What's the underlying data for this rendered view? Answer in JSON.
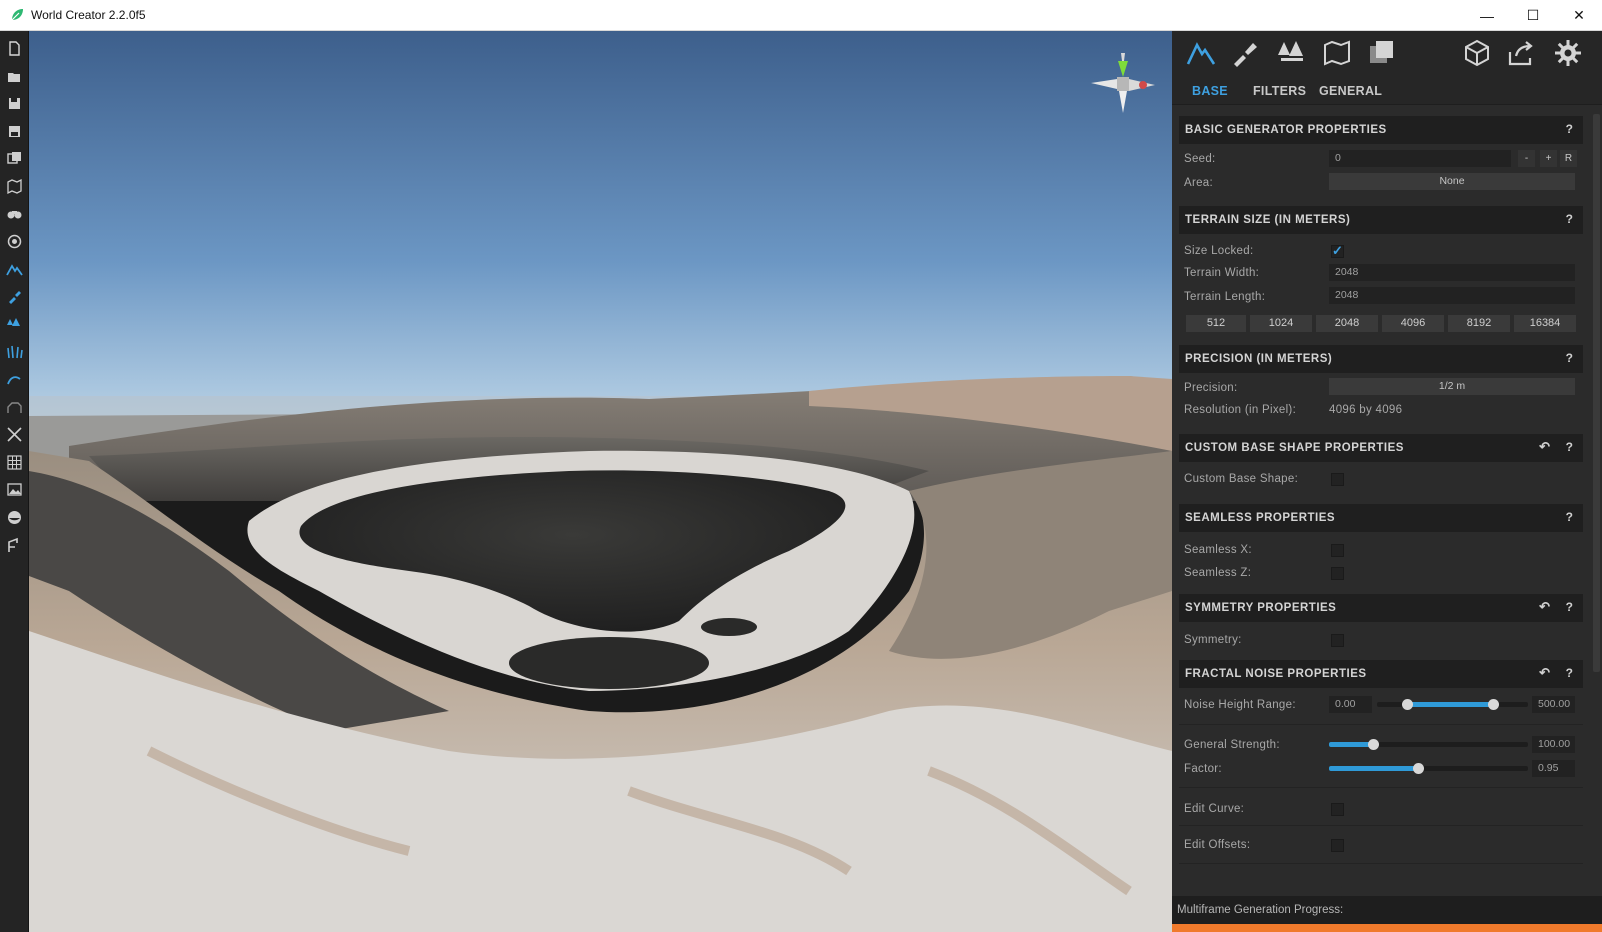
{
  "window": {
    "title": "World Creator 2.2.0f5",
    "icon": "leaf-icon",
    "minimize": "—",
    "maximize": "☐",
    "close": "✕"
  },
  "left_toolbar": [
    "new-file-icon",
    "open-folder-icon",
    "save-icon",
    "save-as-icon",
    "import-icon",
    "map-icon",
    "binoculars-icon",
    "aperture-icon",
    "terrain-icon",
    "brush-icon",
    "trees-icon",
    "grass-icon",
    "water-icon",
    "animals-icon",
    "move-icon",
    "grid-icon",
    "image-icon",
    "sphere-icon",
    "crane-icon"
  ],
  "top_icons": [
    "terrain-icon",
    "brush-icon",
    "trees-icon",
    "map-icon",
    "layers-icon",
    "cube-icon",
    "export-icon",
    "settings-icon"
  ],
  "subtabs": {
    "base": "BASE",
    "filters": "FILTERS",
    "general": "GENERAL"
  },
  "sections": {
    "basic": {
      "title": "BASIC GENERATOR PROPERTIES",
      "help": "?",
      "seed_label": "Seed:",
      "seed_value": "0",
      "minus": "-",
      "plus": "+",
      "reset": "R",
      "area_label": "Area:",
      "area_value": "None"
    },
    "terrain": {
      "title": "TERRAIN SIZE (IN METERS)",
      "help": "?",
      "size_locked_label": "Size Locked:",
      "check": "✓",
      "width_label": "Terrain Width:",
      "width_value": "2048",
      "length_label": "Terrain Length:",
      "length_value": "2048",
      "sizes": [
        "512",
        "1024",
        "2048",
        "4096",
        "8192",
        "16384"
      ]
    },
    "precision": {
      "title": "PRECISION (IN METERS)",
      "help": "?",
      "precision_label": "Precision:",
      "precision_value": "1/2 m",
      "resolution_label": "Resolution (in Pixel):",
      "resolution_value": "4096 by 4096"
    },
    "custom": {
      "title": "CUSTOM BASE SHAPE PROPERTIES",
      "undo": "↶",
      "help": "?",
      "shape_label": "Custom Base Shape:"
    },
    "seamless": {
      "title": "SEAMLESS PROPERTIES",
      "help": "?",
      "x_label": "Seamless X:",
      "z_label": "Seamless Z:"
    },
    "symmetry": {
      "title": "SYMMETRY PROPERTIES",
      "undo": "↶",
      "help": "?",
      "sym_label": "Symmetry:"
    },
    "fractal": {
      "title": "FRACTAL NOISE PROPERTIES",
      "undo": "↶",
      "help": "?",
      "range_label": "Noise Height Range:",
      "range_min": "0.00",
      "range_max": "500.00",
      "strength_label": "General Strength:",
      "strength_value": "100.00",
      "factor_label": "Factor:",
      "factor_value": "0.95",
      "curve_label": "Edit Curve:",
      "offsets_label": "Edit Offsets:"
    }
  },
  "progress": {
    "label": "Multiframe Generation Progress:",
    "fraction": 1.0
  },
  "colors": {
    "accent": "#3ea0e0",
    "progress": "#f07a2c",
    "panel": "#2b2b2b"
  }
}
